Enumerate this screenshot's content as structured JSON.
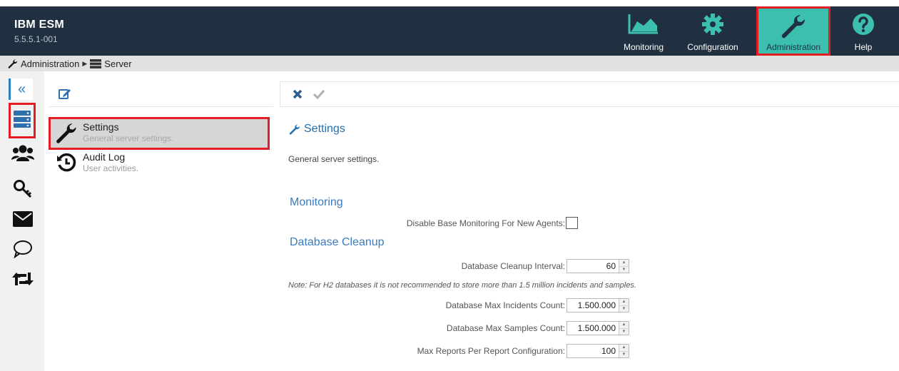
{
  "app": {
    "name": "IBM ESM",
    "version": "5.5.5.1-001"
  },
  "nav": {
    "monitoring": "Monitoring",
    "configuration": "Configuration",
    "administration": "Administration",
    "help": "Help",
    "active": "administration"
  },
  "breadcrumb": {
    "parent": "Administration",
    "current": "Server"
  },
  "rail": {
    "items": [
      "collapse-icon",
      "server-icon",
      "users-icon",
      "key-icon",
      "envelope-icon",
      "comment-icon",
      "retweet-icon"
    ],
    "selected": "server-icon"
  },
  "tree": {
    "items": [
      {
        "title": "Settings",
        "subtitle": "General server settings.",
        "icon": "wrench-icon",
        "active": true
      },
      {
        "title": "Audit Log",
        "subtitle": "User activities.",
        "icon": "history-icon",
        "active": false
      }
    ]
  },
  "content": {
    "title": "Settings",
    "description": "General server settings.",
    "monitoring": {
      "heading": "Monitoring",
      "disable_base_label": "Disable Base Monitoring For New Agents:",
      "disable_base_checked": false
    },
    "cleanup": {
      "heading": "Database Cleanup",
      "interval_label": "Database Cleanup Interval:",
      "interval_value": "60",
      "note": "Note: For H2 databases it is not recommended to store more than 1.5 million incidents and samples.",
      "max_incidents_label": "Database Max Incidents Count:",
      "max_incidents_value": "1.500.000",
      "max_samples_label": "Database Max Samples Count:",
      "max_samples_value": "1.500.000",
      "max_reports_label": "Max Reports Per Report Configuration:",
      "max_reports_value": "100"
    }
  },
  "colors": {
    "header_bg": "#203040",
    "active_tab_bg": "#3dbfb0",
    "highlight": "#e21d24",
    "accent_blue": "#3a7bbf"
  }
}
